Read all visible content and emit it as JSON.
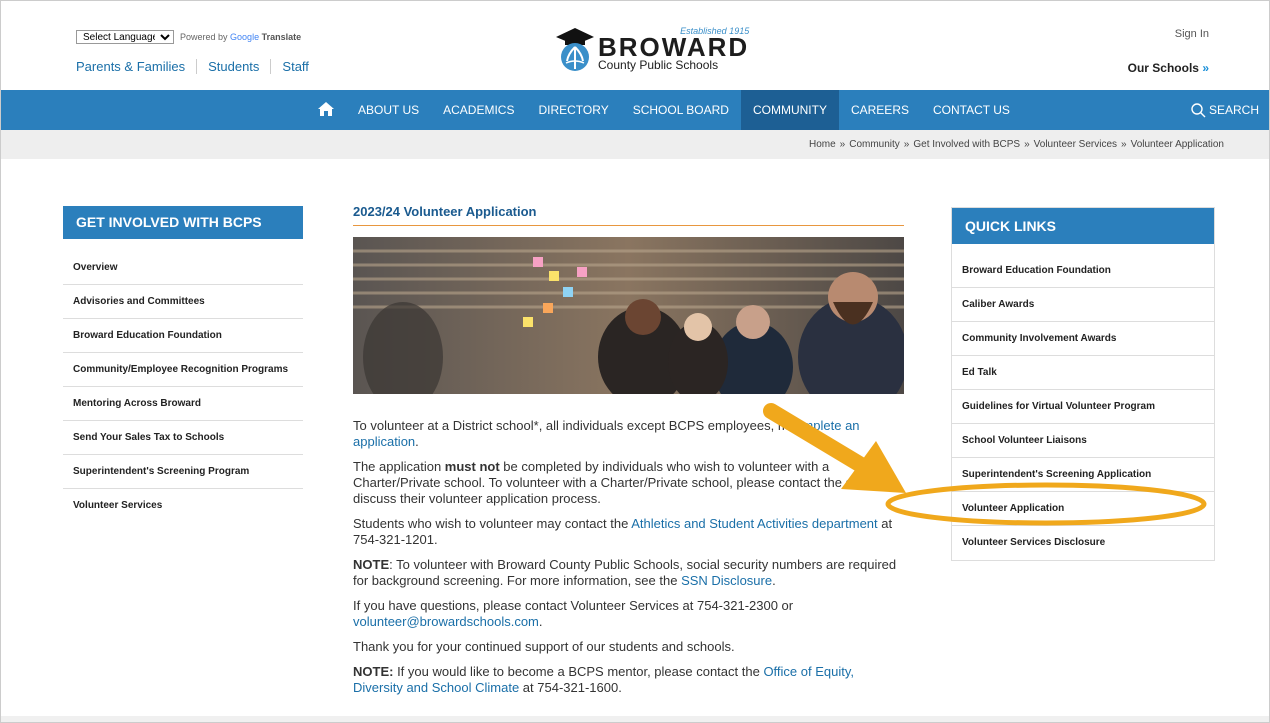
{
  "header": {
    "language_select": "Select Language",
    "powered_by": "Powered by",
    "google": "Google",
    "translate": "Translate",
    "user_links": [
      "Parents & Families",
      "Students",
      "Staff"
    ],
    "logo": {
      "established": "Established 1915",
      "name": "BROWARD",
      "subtitle": "County Public Schools"
    },
    "sign_in": "Sign In",
    "our_schools": "Our Schools",
    "our_schools_arrow": "»"
  },
  "nav": {
    "items": [
      "ABOUT US",
      "ACADEMICS",
      "DIRECTORY",
      "SCHOOL BOARD",
      "COMMUNITY",
      "CAREERS",
      "CONTACT US"
    ],
    "active": "COMMUNITY",
    "search": "SEARCH"
  },
  "breadcrumb": [
    "Home",
    "»",
    "Community",
    "»",
    "Get Involved with BCPS",
    "»",
    "Volunteer Services",
    "»",
    "Volunteer Application"
  ],
  "sidebar": {
    "title": "GET INVOLVED WITH BCPS",
    "items": [
      "Overview",
      "Advisories and Committees",
      "Broward Education Foundation",
      "Community/Employee Recognition Programs",
      "Mentoring Across Broward",
      "Send Your Sales Tax to Schools",
      "Superintendent's Screening Program",
      "Volunteer Services"
    ]
  },
  "main": {
    "title": "2023/24 Volunteer Application",
    "p1_a": "To volunteer at a District school*, all individuals except BCPS employees, m",
    "p1_link": "complete an application",
    "p1_b": ".",
    "p2_a": "The application ",
    "p2_bold": "must not",
    "p2_b": " be completed by individuals who wish to volunteer with a Charter/Private school. To volunteer with a Charter/Private school, please contact the school to discuss their volunteer application process.",
    "p3_a": "Students who wish to volunteer may contact the ",
    "p3_link": "Athletics and Student Activities department",
    "p3_b": " at 754-321-1201.",
    "p4_bold": "NOTE",
    "p4_a": ": To volunteer with Broward County Public Schools, social security numbers are required for background screening. For more information, see the ",
    "p4_link": "SSN Disclosure",
    "p4_b": ".",
    "p5_a": "If you have questions, please contact Volunteer Services at 754-321-2300 or ",
    "p5_link": "volunteer@browardschools.com",
    "p5_b": ".",
    "p6": "Thank you for your continued support of our students and schools.",
    "p7_bold": "NOTE:",
    "p7_a": " If you would like to become a BCPS mentor, please contact the ",
    "p7_link": "Office of Equity, Diversity and School Climate",
    "p7_b": " at 754-321-1600."
  },
  "quick_links": {
    "title": "QUICK LINKS",
    "items": [
      "Broward Education Foundation",
      "Caliber Awards",
      "Community Involvement Awards",
      "Ed Talk",
      "Guidelines for Virtual Volunteer Program",
      "School Volunteer Liaisons",
      "Superintendent's Screening Application",
      "Volunteer Application",
      "Volunteer Services Disclosure"
    ]
  },
  "colors": {
    "nav_blue": "#2b7fbc",
    "nav_active": "#1d5f94",
    "link_blue": "#1a6fa8",
    "annotation": "#f0a81c"
  },
  "icons": [
    "home-icon",
    "search-icon",
    "chevron-down-icon",
    "logo-emblem-icon"
  ]
}
